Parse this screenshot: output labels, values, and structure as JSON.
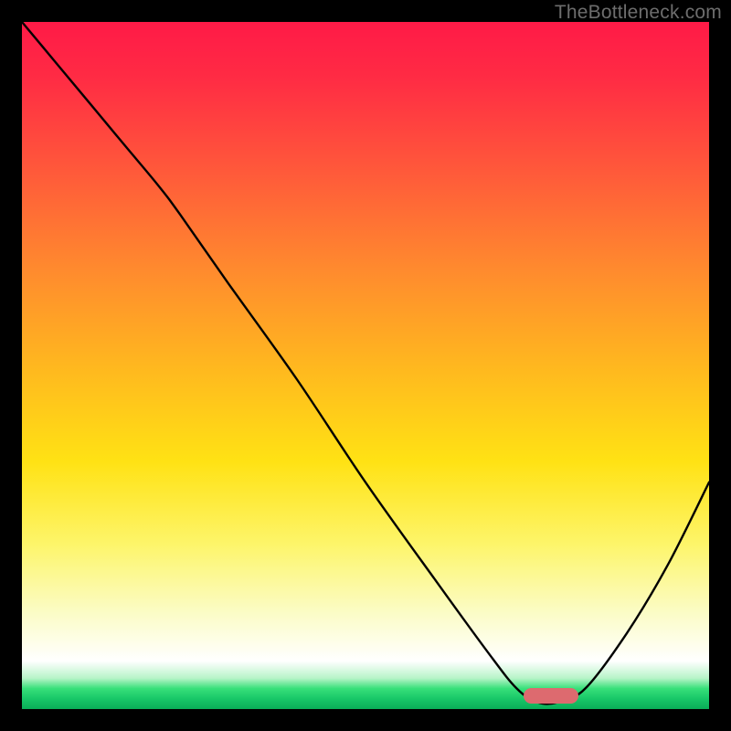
{
  "watermark": "TheBottleneck.com",
  "chart_data": {
    "type": "line",
    "title": "",
    "xlabel": "",
    "ylabel": "",
    "xlim": [
      0,
      100
    ],
    "ylim": [
      0,
      100
    ],
    "grid": false,
    "legend": false,
    "background_gradient_stops": [
      {
        "pct": 0,
        "color": "#ff1a47"
      },
      {
        "pct": 22,
        "color": "#ff5a3a"
      },
      {
        "pct": 50,
        "color": "#ffb71f"
      },
      {
        "pct": 76,
        "color": "#fdf56a"
      },
      {
        "pct": 93,
        "color": "#ffffff"
      },
      {
        "pct": 100,
        "color": "#0aad58"
      }
    ],
    "series": [
      {
        "name": "bottleneck-curve",
        "x": [
          0,
          5,
          10,
          15,
          20,
          23,
          30,
          40,
          50,
          60,
          68,
          72,
          75,
          78,
          82,
          88,
          94,
          100
        ],
        "y": [
          100,
          94,
          88,
          82,
          76,
          72,
          62,
          48,
          33,
          19,
          8,
          3,
          1,
          1,
          3,
          11,
          21,
          33
        ]
      }
    ],
    "marker": {
      "name": "optimal-range",
      "x_start": 73,
      "x_end": 81,
      "y": 2,
      "color": "#dd6a6f"
    }
  }
}
